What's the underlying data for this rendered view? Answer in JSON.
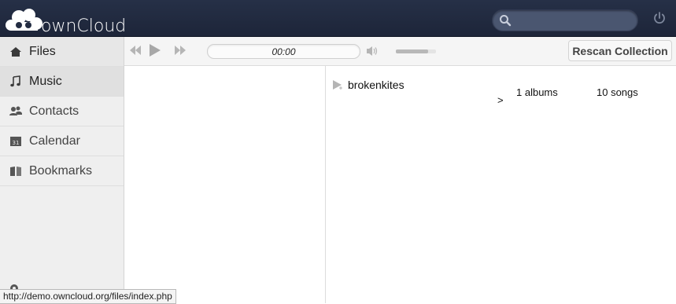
{
  "header": {
    "logo_text": "ownCloud",
    "search": {
      "placeholder": "",
      "value": ""
    }
  },
  "sidebar": {
    "items": [
      {
        "label": "Files",
        "icon": "home-icon"
      },
      {
        "label": "Music",
        "icon": "music-note-icon"
      },
      {
        "label": "Contacts",
        "icon": "contacts-icon"
      },
      {
        "label": "Calendar",
        "icon": "calendar-icon",
        "icon_text": "31"
      },
      {
        "label": "Bookmarks",
        "icon": "bookmarks-icon"
      }
    ]
  },
  "player": {
    "time": "00:00",
    "volume_level": 0.8,
    "rescan_label": "Rescan Collection"
  },
  "collection": {
    "artist": "brokenkites",
    "chevron": ">",
    "albums": "1 albums",
    "songs": "10 songs"
  },
  "status_url": "http://demo.owncloud.org/files/index.php",
  "colors": {
    "header_bg": "#232c42",
    "sidebar_bg": "#efefef",
    "active_item_bg": "#e0e0e0"
  }
}
